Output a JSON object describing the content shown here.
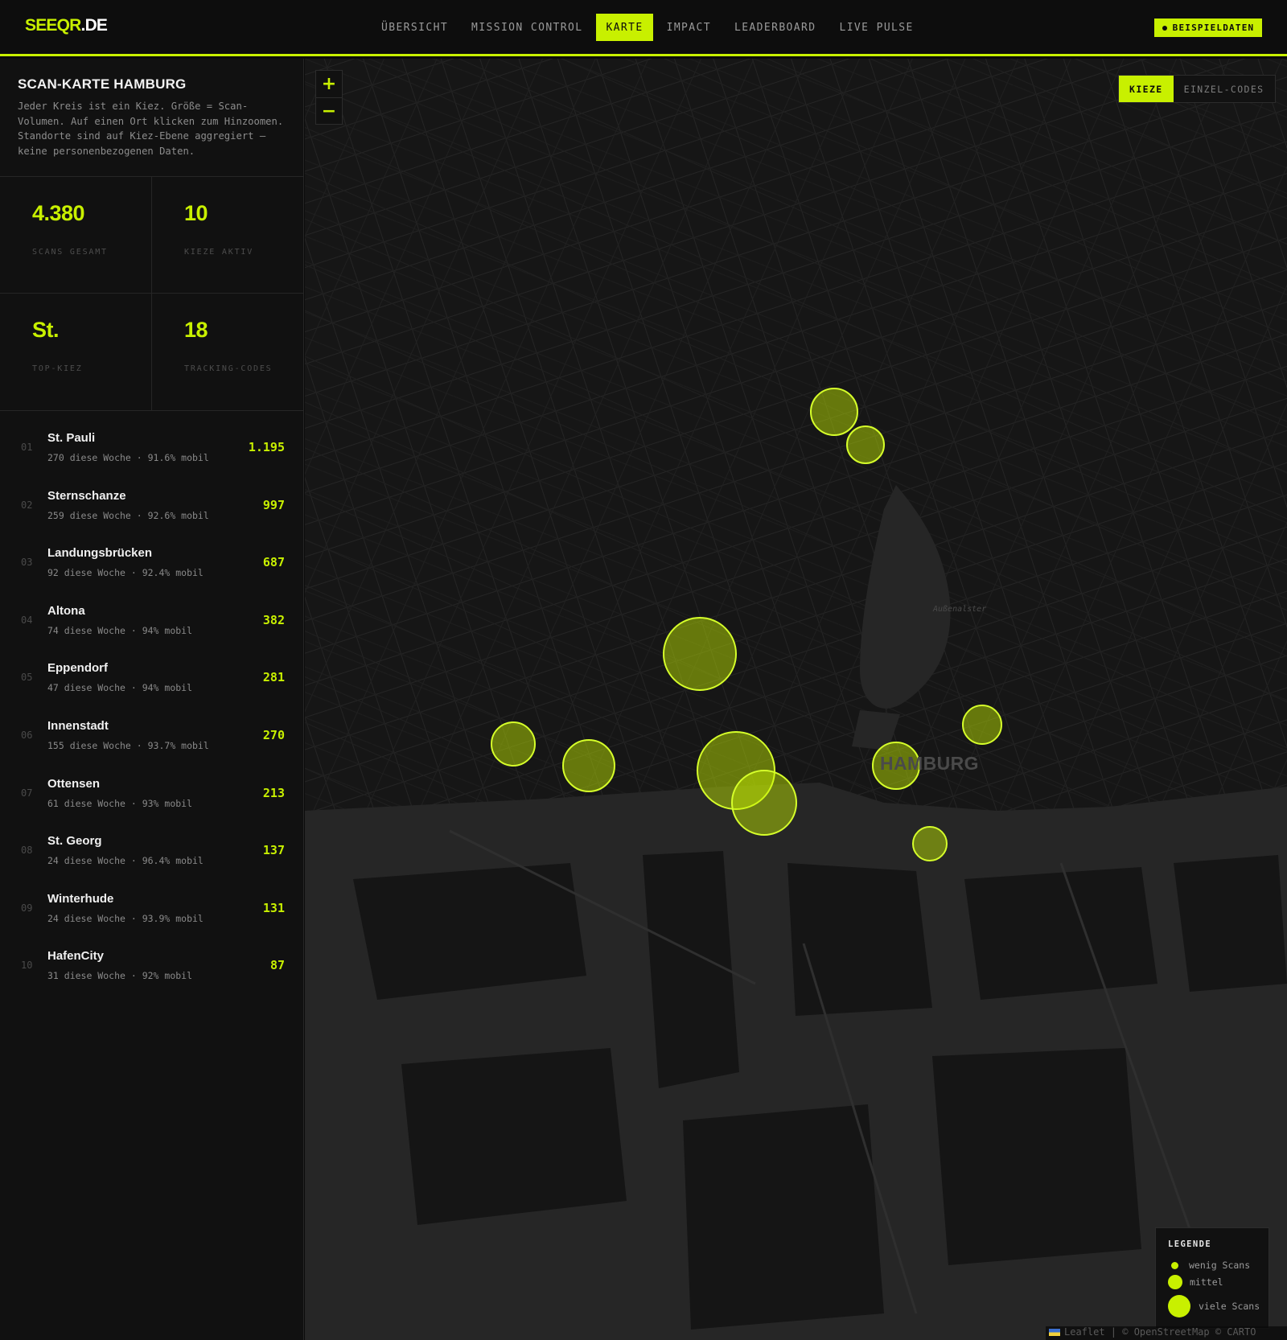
{
  "header": {
    "logo_main": "SEEQR",
    "logo_suffix": ".DE",
    "nav": [
      "ÜBERSICHT",
      "MISSION CONTROL",
      "KARTE",
      "IMPACT",
      "LEADERBOARD",
      "LIVE PULSE"
    ],
    "active_nav": "KARTE",
    "badge": "BEISPIELDATEN"
  },
  "sidebar": {
    "title": "SCAN-KARTE HAMBURG",
    "description": "Jeder Kreis ist ein Kiez. Größe = Scan-Volumen. Auf einen Ort klicken zum Hinzoomen. Standorte sind auf Kiez-Ebene aggregiert — keine personenbezogenen Daten.",
    "stats": [
      {
        "value": "4.380",
        "label": "SCANS GESAMT"
      },
      {
        "value": "10",
        "label": "KIEZE AKTIV"
      },
      {
        "value": "St.",
        "label": "TOP-KIEZ"
      },
      {
        "value": "18",
        "label": "TRACKING-CODES"
      }
    ],
    "ranking": [
      {
        "rank": "01",
        "name": "St. Pauli",
        "sub": "270 diese Woche · 91.6% mobil",
        "value": "1.195"
      },
      {
        "rank": "02",
        "name": "Sternschanze",
        "sub": "259 diese Woche · 92.6% mobil",
        "value": "997"
      },
      {
        "rank": "03",
        "name": "Landungsbrücken",
        "sub": "92 diese Woche · 92.4% mobil",
        "value": "687"
      },
      {
        "rank": "04",
        "name": "Altona",
        "sub": "74 diese Woche · 94% mobil",
        "value": "382"
      },
      {
        "rank": "05",
        "name": "Eppendorf",
        "sub": "47 diese Woche · 94% mobil",
        "value": "281"
      },
      {
        "rank": "06",
        "name": "Innenstadt",
        "sub": "155 diese Woche · 93.7% mobil",
        "value": "270"
      },
      {
        "rank": "07",
        "name": "Ottensen",
        "sub": "61 diese Woche · 93% mobil",
        "value": "213"
      },
      {
        "rank": "08",
        "name": "St. Georg",
        "sub": "24 diese Woche · 96.4% mobil",
        "value": "137"
      },
      {
        "rank": "09",
        "name": "Winterhude",
        "sub": "24 diese Woche · 93.9% mobil",
        "value": "131"
      },
      {
        "rank": "10",
        "name": "HafenCity",
        "sub": "31 diese Woche · 92% mobil",
        "value": "87"
      }
    ]
  },
  "map": {
    "zoom_in": "+",
    "zoom_out": "−",
    "modes": [
      "KIEZE",
      "EINZEL-CODES"
    ],
    "active_mode": "KIEZE",
    "city_label": "HAMBURG",
    "lake_label": "Außenalster",
    "legend": {
      "title": "LEGENDE",
      "items": [
        "wenig Scans",
        "mittel",
        "viele Scans"
      ]
    },
    "attribution": "Leaflet | © OpenStreetMap © CARTO",
    "accent_color": "#c8f000"
  }
}
